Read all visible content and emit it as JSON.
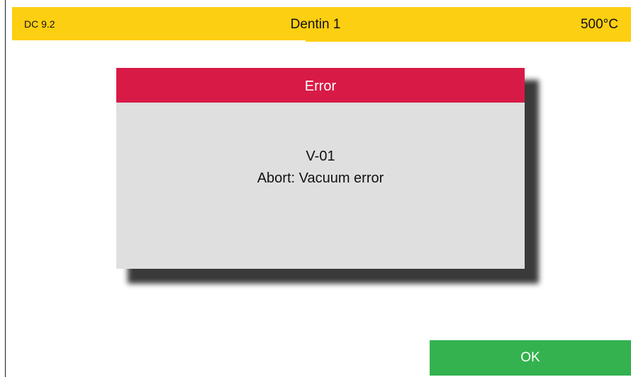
{
  "header": {
    "program_code": "DC 9.2",
    "program_name": "Dentin 1",
    "temperature": "500°C"
  },
  "dialog": {
    "title": "Error",
    "error_code": "V-01",
    "message": "Abort: Vacuum error"
  },
  "actions": {
    "ok_label": "OK"
  },
  "colors": {
    "header_bg": "#fdcf12",
    "dialog_header_bg": "#d81a46",
    "dialog_body_bg": "#dfdfdf",
    "ok_button_bg": "#33b24f"
  }
}
